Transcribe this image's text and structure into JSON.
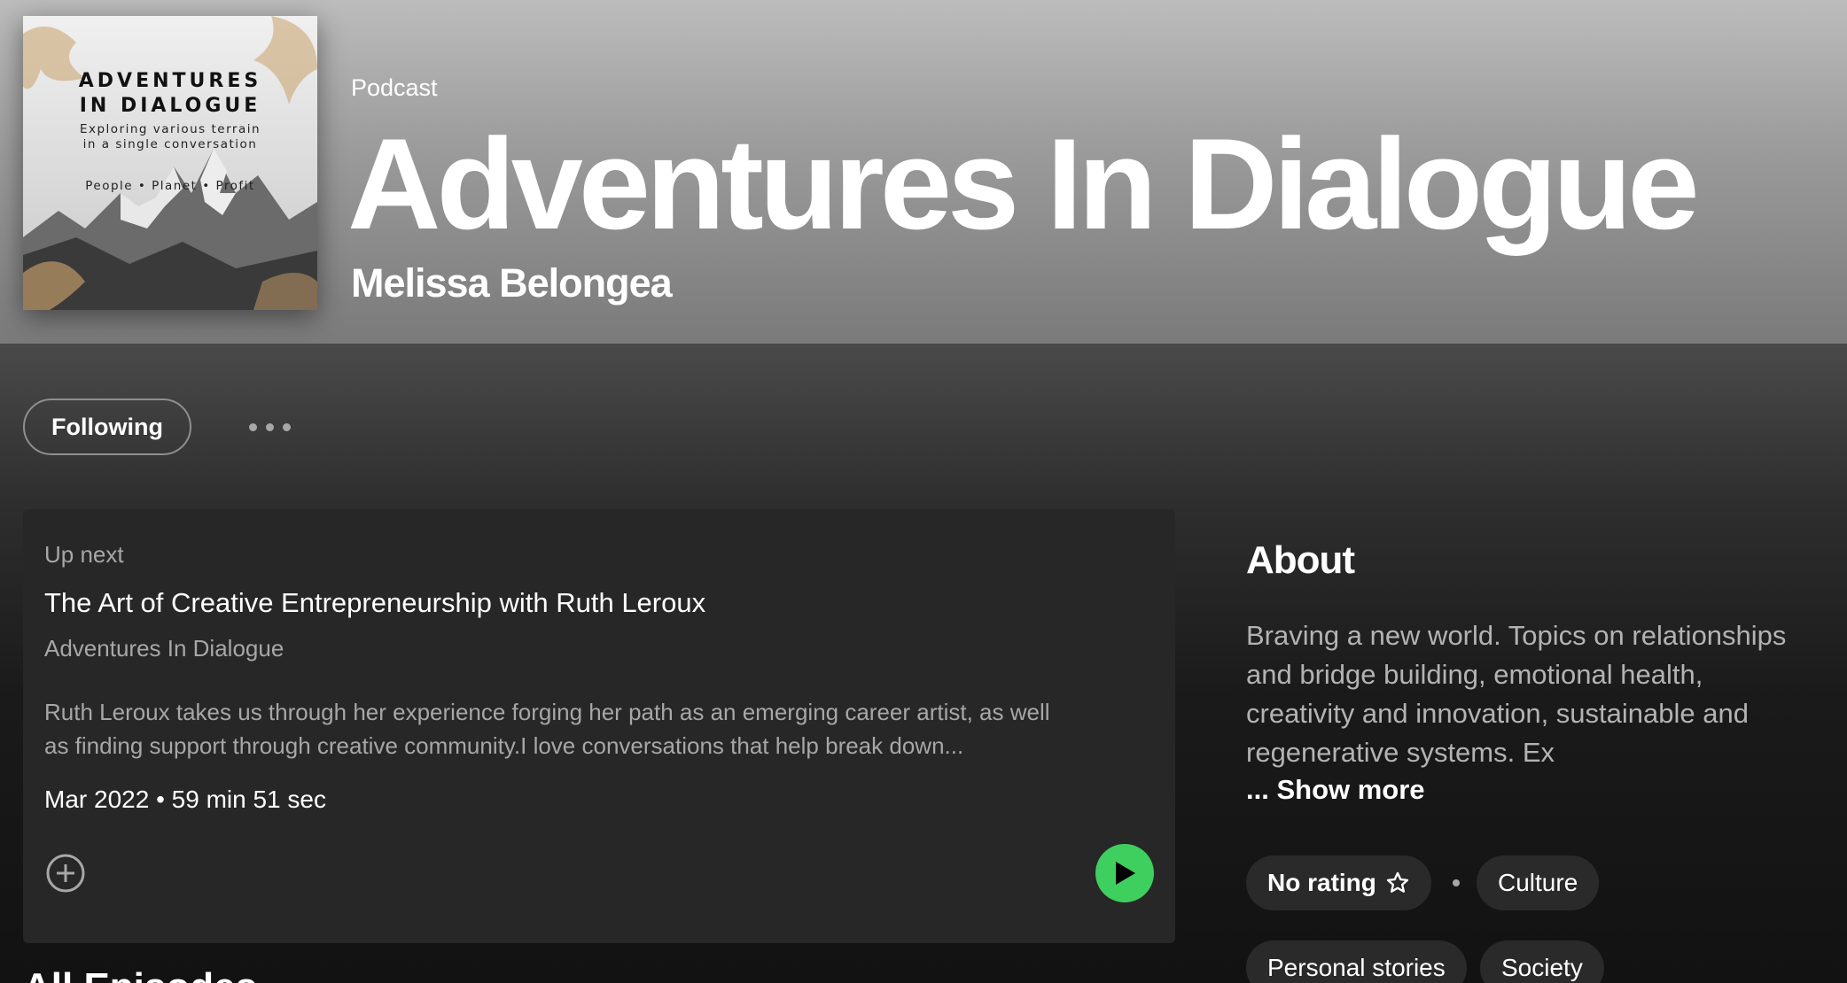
{
  "header": {
    "kind": "Podcast",
    "title": "Adventures In Dialogue",
    "author": "Melissa Belongea"
  },
  "cover": {
    "title_line1": "ADVENTURES",
    "title_line2": "IN DIALOGUE",
    "subtitle_line1": "Exploring various terrain",
    "subtitle_line2": "in a single conversation",
    "tags": "People • Planet • Profit"
  },
  "actions": {
    "follow_label": "Following",
    "more_icon": "more-horizontal-icon"
  },
  "up_next": {
    "label": "Up next",
    "title": "The Art of Creative Entrepreneurship with Ruth Leroux",
    "show": "Adventures In Dialogue",
    "description_line1": "Ruth Leroux takes us through her experience forging her path as an emerging career artist, as well",
    "description_line2": "as finding support through creative community.I love conversations that help break down...",
    "meta": "Mar 2022 • 59 min 51 sec",
    "add_icon": "plus-circle-icon",
    "play_icon": "play-icon",
    "play_color": "#3fcf5e"
  },
  "about": {
    "heading": "About",
    "text_line1": "Braving a new world. Topics on relationships",
    "text_line2": "and bridge building, emotional health,",
    "text_line3": "creativity and innovation, sustainable and",
    "text_line4": "regenerative systems. Ex",
    "show_more": "... Show more",
    "rating_label": "No rating",
    "rating_icon": "star-outline-icon",
    "tags": [
      "Culture",
      "Personal stories",
      "Society"
    ]
  },
  "section_peek": "All Episodes"
}
